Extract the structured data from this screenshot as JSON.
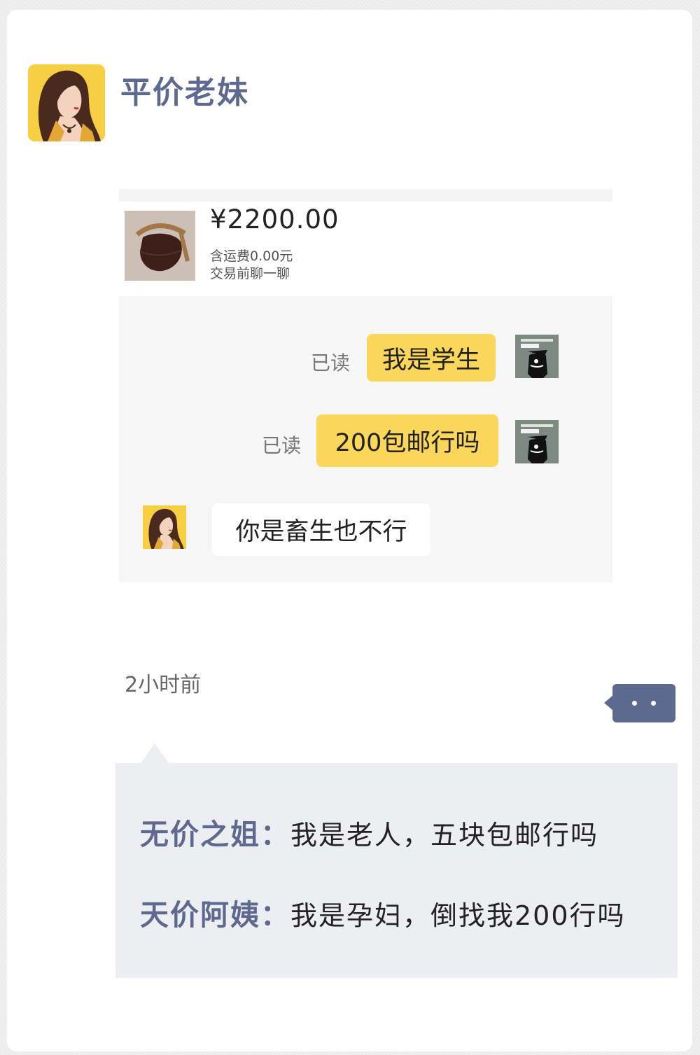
{
  "header": {
    "username": "平价老妹",
    "avatar_icon": "woman-avatar-icon"
  },
  "product": {
    "image_icon": "handbag-image",
    "price": "¥2200.00",
    "shipping": "含运费0.00元",
    "chat_prompt": "交易前聊一聊"
  },
  "chat": {
    "messages": [
      {
        "read": "已读",
        "text": "我是学生",
        "from": "buyer"
      },
      {
        "read": "已读",
        "text": "200包邮行吗",
        "from": "buyer"
      },
      {
        "text": "你是畜生也不行",
        "from": "seller"
      }
    ]
  },
  "time_ago": "2小时前",
  "more_button_icon": "more-dots-icon",
  "comments": [
    {
      "author": "无价之姐：",
      "text": "我是老人，五块包邮行吗"
    },
    {
      "author": "天价阿姨：",
      "text": "我是孕妇，倒找我200行吗"
    }
  ],
  "colors": {
    "accent": "#5e6990",
    "bubble_yellow": "#fad65a",
    "avatar_yellow": "#f7cf42"
  }
}
